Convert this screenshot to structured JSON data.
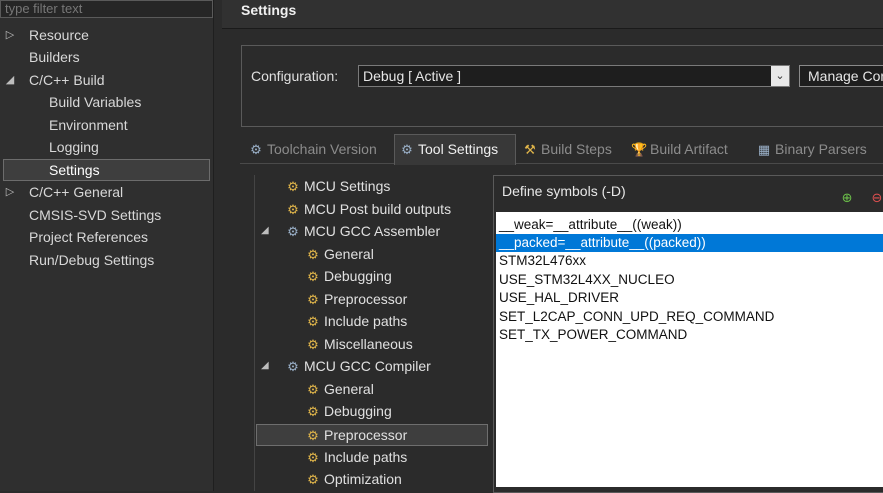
{
  "filter": {
    "placeholder": "type filter text"
  },
  "left_tree": {
    "items": [
      {
        "label": "Resource",
        "twisty": "▷"
      },
      {
        "label": "Builders",
        "twisty": ""
      },
      {
        "label": "C/C++ Build",
        "twisty": "◢"
      },
      {
        "label": "Build Variables",
        "twisty": ""
      },
      {
        "label": "Environment",
        "twisty": ""
      },
      {
        "label": "Logging",
        "twisty": ""
      },
      {
        "label": "Settings",
        "twisty": "",
        "selected": true
      },
      {
        "label": "C/C++ General",
        "twisty": "▷"
      },
      {
        "label": "CMSIS-SVD Settings",
        "twisty": ""
      },
      {
        "label": "Project References",
        "twisty": ""
      },
      {
        "label": "Run/Debug Settings",
        "twisty": ""
      }
    ]
  },
  "settings": {
    "title": "Settings",
    "configuration_label": "Configuration:",
    "configuration_value": "Debug  [ Active ]",
    "dropdown_arrow": "⌄",
    "manage_button": "Manage Configurations..."
  },
  "tabs": [
    {
      "label": "Toolchain  Version",
      "icon": "gear-icon"
    },
    {
      "label": "Tool Settings",
      "icon": "gear-icon",
      "active": true
    },
    {
      "label": "Build Steps",
      "icon": "hammer-icon"
    },
    {
      "label": "Build Artifact",
      "icon": "trophy-icon"
    },
    {
      "label": "Binary Parsers",
      "icon": "binary-icon"
    }
  ],
  "tool_tree": {
    "items": [
      {
        "label": "MCU Settings"
      },
      {
        "label": "MCU Post build outputs"
      },
      {
        "label": "MCU GCC Assembler",
        "twisty": "◢"
      },
      {
        "label": "General"
      },
      {
        "label": "Debugging"
      },
      {
        "label": "Preprocessor"
      },
      {
        "label": "Include paths"
      },
      {
        "label": "Miscellaneous"
      },
      {
        "label": "MCU GCC Compiler",
        "twisty": "◢"
      },
      {
        "label": "General"
      },
      {
        "label": "Debugging"
      },
      {
        "label": "Preprocessor",
        "selected": true
      },
      {
        "label": "Include paths"
      },
      {
        "label": "Optimization"
      }
    ]
  },
  "define_symbols": {
    "title": "Define symbols (-D)",
    "items": [
      "__weak=__attribute__((weak))",
      "__packed=__attribute__((packed))",
      "STM32L476xx",
      "USE_STM32L4XX_NUCLEO",
      "USE_HAL_DRIVER",
      "SET_L2CAP_CONN_UPD_REQ_COMMAND",
      "SET_TX_POWER_COMMAND"
    ],
    "selected_index": 1
  }
}
